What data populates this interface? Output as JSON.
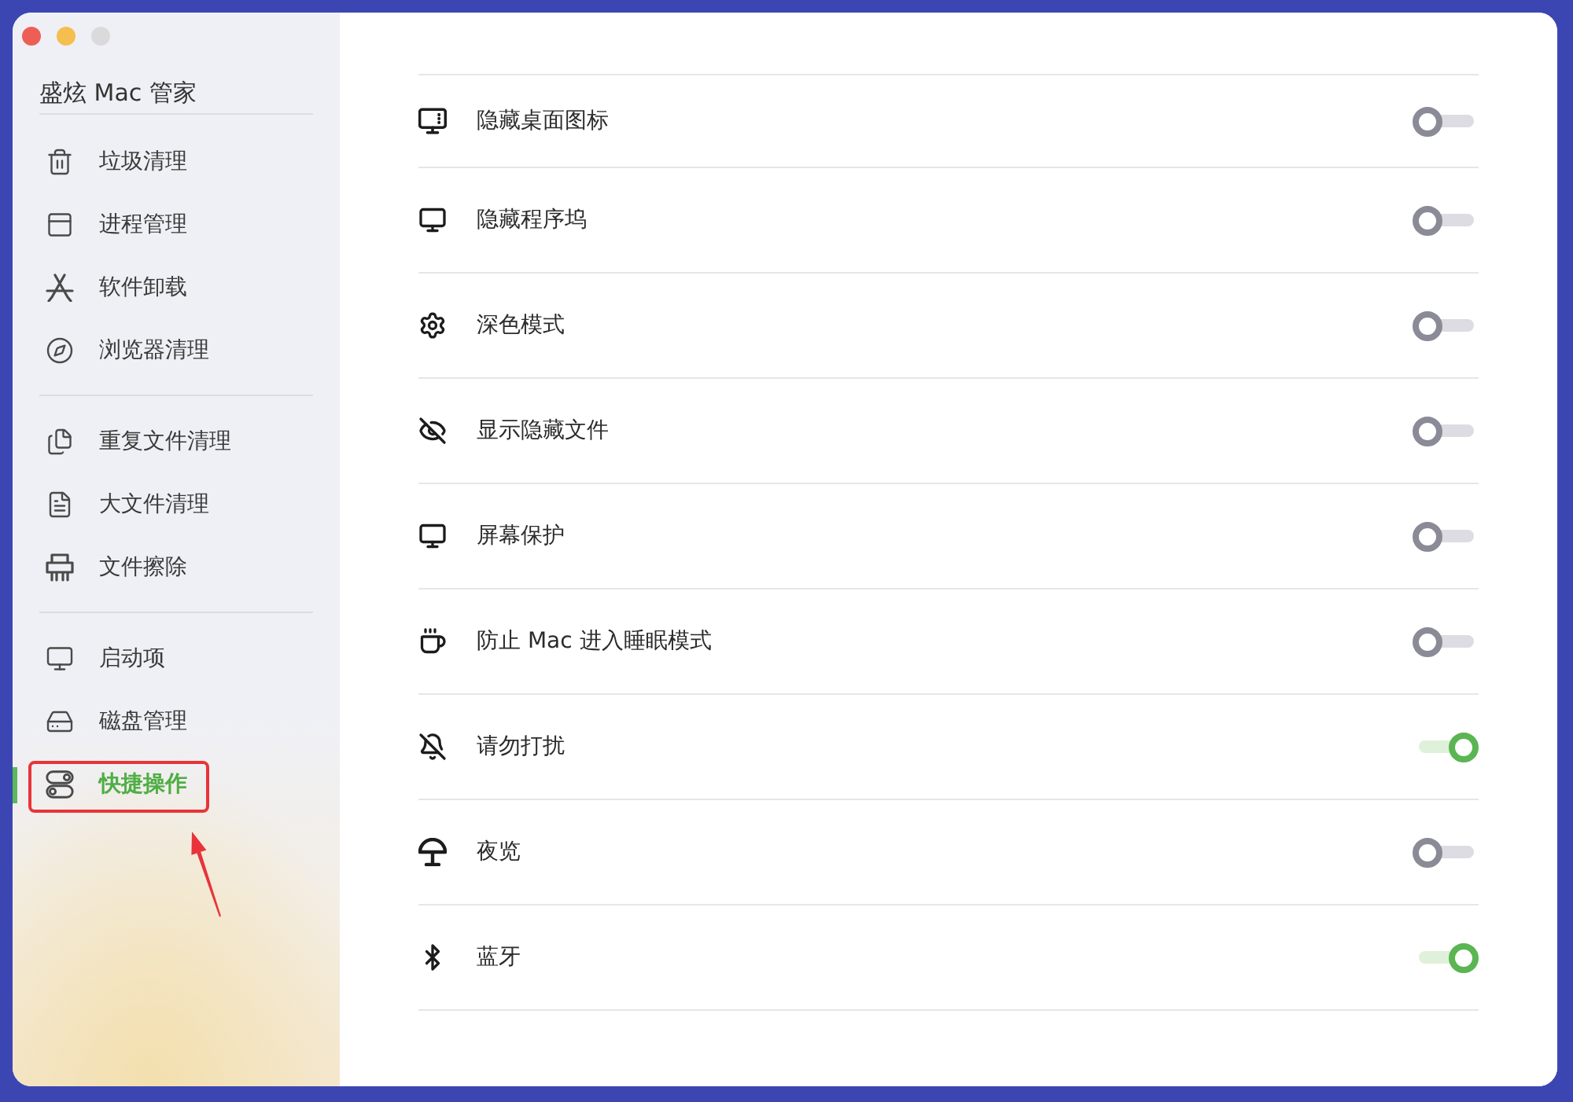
{
  "window": {
    "controls": [
      {
        "color": "#ed5f56"
      },
      {
        "color": "#f4bf4f"
      },
      {
        "color": "#dadadd"
      }
    ]
  },
  "sidebar": {
    "title": "盛炫 Mac 管家",
    "groups": [
      {
        "items": [
          {
            "label": "垃圾清理",
            "selected": false
          },
          {
            "label": "进程管理",
            "selected": false
          },
          {
            "label": "软件卸载",
            "selected": false
          },
          {
            "label": "浏览器清理",
            "selected": false
          }
        ]
      },
      {
        "items": [
          {
            "label": "重复文件清理",
            "selected": false
          },
          {
            "label": "大文件清理",
            "selected": false
          },
          {
            "label": "文件擦除",
            "selected": false
          }
        ]
      },
      {
        "items": [
          {
            "label": "启动项",
            "selected": false
          },
          {
            "label": "磁盘管理",
            "selected": false
          },
          {
            "label": "快捷操作",
            "selected": true
          }
        ]
      }
    ]
  },
  "settings": [
    {
      "label": "隐藏桌面图标",
      "on": false
    },
    {
      "label": "隐藏程序坞",
      "on": false
    },
    {
      "label": "深色模式",
      "on": false
    },
    {
      "label": "显示隐藏文件",
      "on": false
    },
    {
      "label": "屏幕保护",
      "on": false
    },
    {
      "label": "防止 Mac 进入睡眠模式",
      "on": false
    },
    {
      "label": "请勿打扰",
      "on": true
    },
    {
      "label": "夜览",
      "on": false
    },
    {
      "label": "蓝牙",
      "on": true
    }
  ]
}
